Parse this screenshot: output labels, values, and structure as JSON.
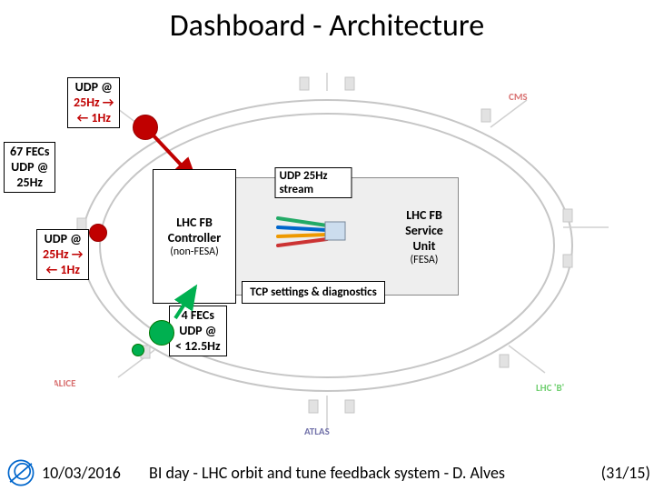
{
  "title": "Dashboard - Architecture",
  "labels": {
    "udp_top": {
      "line1": "UDP @",
      "line2": "25Hz →",
      "line3": "← 1Hz"
    },
    "fecs_left": {
      "line1": "67 FECs",
      "line2": "UDP @",
      "line3": "25Hz"
    },
    "udp_left": {
      "line1": "UDP @",
      "line2": "25Hz →",
      "line3": "← 1Hz"
    },
    "fecs_bottom": {
      "line1": "4 FECs",
      "line2": "UDP @",
      "line3": "< 12.5Hz"
    }
  },
  "center": {
    "stream_label": "UDP 25Hz stream",
    "controller": {
      "l1": "LHC FB",
      "l2": "Controller",
      "l3": "(non-FESA)"
    },
    "tcp_label": "TCP settings & diagnostics",
    "service": {
      "l1": "LHC FB",
      "l2": "Service",
      "l3": "Unit",
      "l4": "(FESA)"
    }
  },
  "facilities": {
    "cms": "CMS",
    "alice": "ALICE",
    "atlas": "ATLAS",
    "lhcb": "LHC 'B'"
  },
  "footer": {
    "date": "10/03/2016",
    "center": "BI day - LHC orbit and tune feedback system - D. Alves",
    "page": "(31/15)"
  }
}
